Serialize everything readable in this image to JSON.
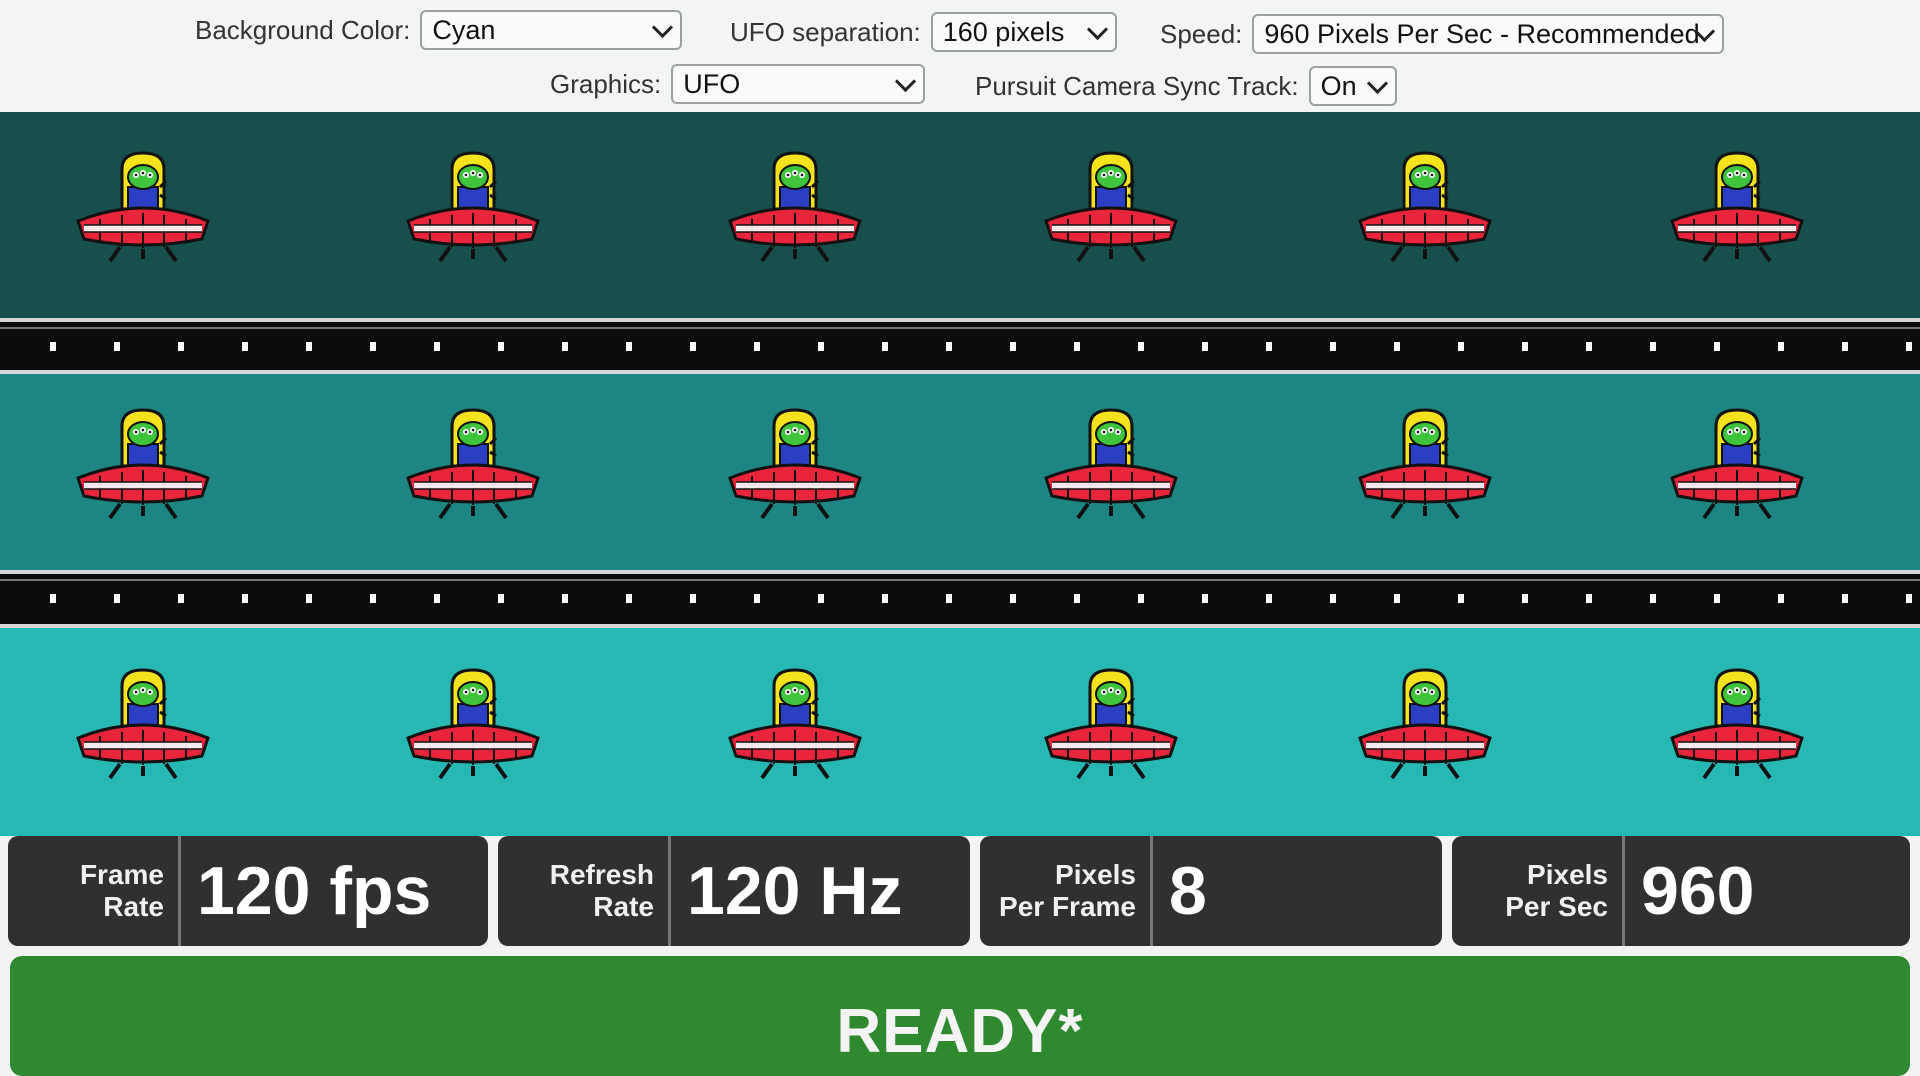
{
  "controls": {
    "background_color": {
      "label": "Background Color:",
      "value": "Cyan"
    },
    "ufo_separation": {
      "label": "UFO separation:",
      "value": "160 pixels"
    },
    "speed": {
      "label": "Speed:",
      "value": "960 Pixels Per Sec - Recommended"
    },
    "graphics": {
      "label": "Graphics:",
      "value": "UFO"
    },
    "pursuit_camera": {
      "label": "Pursuit Camera Sync Track:",
      "value": "On"
    }
  },
  "track": {
    "lanes": [
      {
        "color": "#174f4d"
      },
      {
        "color": "#1d8682"
      },
      {
        "color": "#27b8b4"
      }
    ],
    "ufos_per_lane": 6,
    "ufo_icon": "alien-ufo-icon"
  },
  "stats": [
    {
      "label_line1": "Frame",
      "label_line2": "Rate",
      "value": "120 fps"
    },
    {
      "label_line1": "Refresh",
      "label_line2": "Rate",
      "value": "120 Hz"
    },
    {
      "label_line1": "Pixels",
      "label_line2": "Per Frame",
      "value": "8"
    },
    {
      "label_line1": "Pixels",
      "label_line2": "Per Sec",
      "value": "960"
    }
  ],
  "status": {
    "text": "READY*"
  },
  "colors": {
    "ready_green": "#2f8a2f",
    "stat_panel": "#2f3030",
    "ufo_red": "#e8253a"
  }
}
